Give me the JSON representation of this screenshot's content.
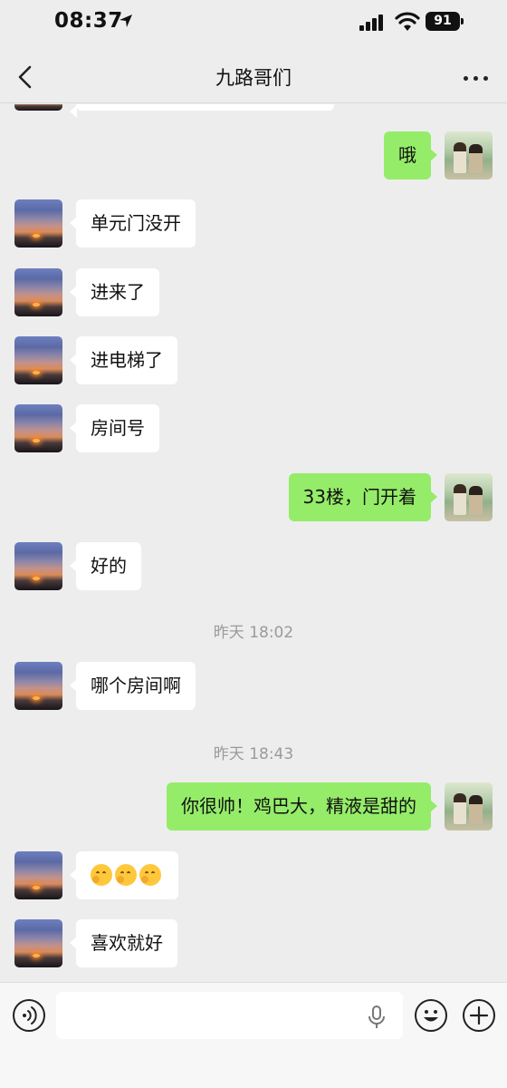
{
  "status_bar": {
    "time": "08:37",
    "battery": "91"
  },
  "nav": {
    "title": "九路哥们"
  },
  "timestamps": [
    "昨天 18:02",
    "昨天 18:43"
  ],
  "messages": [
    {
      "side": "right",
      "text": "哦"
    },
    {
      "side": "left",
      "text": "单元门没开"
    },
    {
      "side": "left",
      "text": "进来了"
    },
    {
      "side": "left",
      "text": "进电梯了"
    },
    {
      "side": "left",
      "text": "房间号"
    },
    {
      "side": "right",
      "text": "33楼，门开着"
    },
    {
      "side": "left",
      "text": "好的"
    },
    {
      "side": "left",
      "text": "哪个房间啊"
    },
    {
      "side": "right",
      "text": "你很帅！鸡巴大，精液是甜的"
    },
    {
      "side": "left",
      "text": "",
      "emoji": [
        "thinking-face-icon",
        "thinking-face-icon",
        "thinking-face-icon"
      ]
    },
    {
      "side": "left",
      "text": "喜欢就好"
    }
  ],
  "input": {
    "value": "",
    "placeholder": ""
  },
  "icons": {
    "back": "chevron-left-icon",
    "more": "more-dots-icon",
    "voice": "voice-icon",
    "mic": "mic-icon",
    "emoji": "emoji-icon",
    "plus": "plus-icon"
  },
  "colors": {
    "background": "#ededed",
    "outgoing_bubble": "#95ec69",
    "incoming_bubble": "#ffffff",
    "timestamp": "#9a9a9a"
  }
}
